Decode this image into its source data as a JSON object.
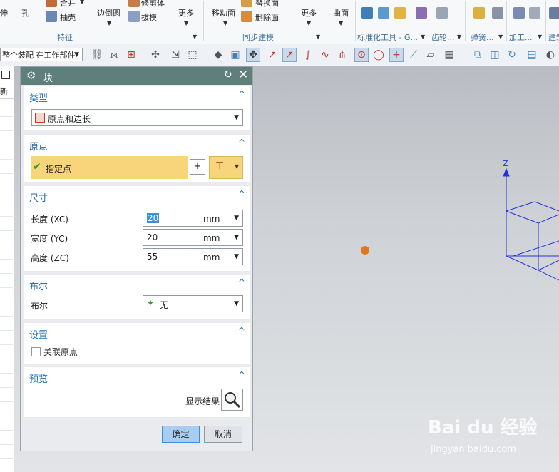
{
  "ribbon": {
    "items": {
      "extend": "伸",
      "hole": "孔",
      "combine": "合并",
      "shell": "抽壳",
      "edge_blend": "边倒圆",
      "trim_body": "修剪体",
      "draft": "拔模",
      "more1": "更多",
      "move_face": "移动面",
      "replace_face": "替换面",
      "delete_face": "删除面",
      "more2": "更多",
      "surface": "曲面"
    },
    "groups": {
      "feature": "特征",
      "sync_modeling": "同步建模",
      "standard_parts": "标准化工具 - G...",
      "gear": "齿轮...",
      "spring": "弹簧...",
      "process": "加工...",
      "build": "建筑..."
    }
  },
  "toolbar": {
    "selection_filter": "整个装配 在工作部件内"
  },
  "left_strip": {
    "header": "新"
  },
  "dialog": {
    "title": "块",
    "type_section": {
      "label": "类型",
      "value": "原点和边长"
    },
    "origin_section": {
      "label": "原点",
      "specify_point": "指定点"
    },
    "dimensions_section": {
      "label": "尺寸",
      "rows": [
        {
          "label": "长度 (XC)",
          "value": "20",
          "unit": "mm"
        },
        {
          "label": "宽度 (YC)",
          "value": "20",
          "unit": "mm"
        },
        {
          "label": "高度 (ZC)",
          "value": "55",
          "unit": "mm"
        }
      ]
    },
    "boolean_section": {
      "label": "布尔",
      "row_label": "布尔",
      "value": "无"
    },
    "settings_section": {
      "label": "设置",
      "associative_origin": "关联原点",
      "checked": false
    },
    "preview_section": {
      "label": "预览",
      "show_result": "显示结果"
    },
    "ok": "确定",
    "cancel": "取消"
  },
  "viewport": {
    "axis_label": "Z"
  },
  "watermark": {
    "brand": "Bai du 经验",
    "url": "jingyan.baidu.com"
  },
  "colors": {
    "accent": "#1e6fb5",
    "dialog_title": "#5e7f7a",
    "highlight": "#f8d57a",
    "wire": "#2233dd",
    "point": "#e0771c"
  }
}
